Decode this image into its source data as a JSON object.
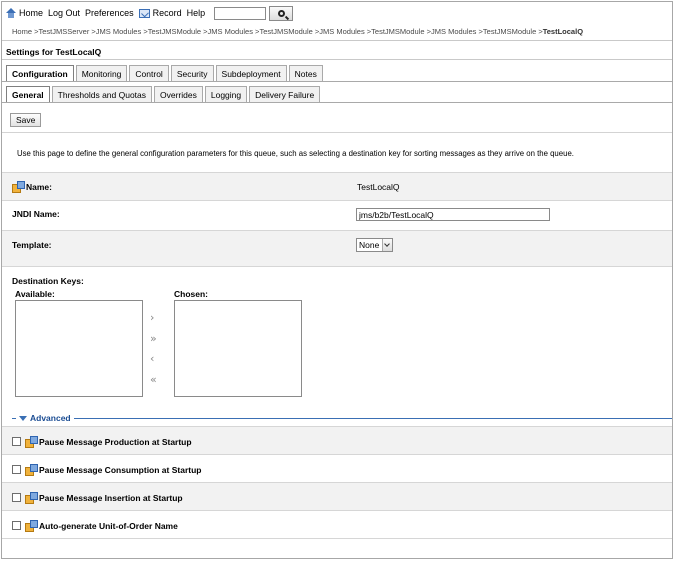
{
  "toolbar": {
    "home": "Home",
    "logout": "Log Out",
    "preferences": "Preferences",
    "record": "Record",
    "help": "Help",
    "search_value": ""
  },
  "breadcrumb": {
    "items": [
      "Home >",
      "TestJMSServer >",
      "JMS Modules >",
      "TestJMSModule >",
      "JMS Modules >",
      "TestJMSModule >",
      "JMS Modules >",
      "TestJMSModule >",
      "JMS Modules >",
      "TestJMSModule >"
    ],
    "current": "TestLocalQ"
  },
  "settings_title": "Settings for TestLocalQ",
  "tabs": [
    "Configuration",
    "Monitoring",
    "Control",
    "Security",
    "Subdeployment",
    "Notes"
  ],
  "subtabs": [
    "General",
    "Thresholds and Quotas",
    "Overrides",
    "Logging",
    "Delivery Failure"
  ],
  "save_label": "Save",
  "description": "Use this page to define the general configuration parameters for this queue, such as selecting a destination key for sorting messages as they arrive on the queue.",
  "form": {
    "name_label": "Name:",
    "name_value": "TestLocalQ",
    "jndi_label": "JNDI Name:",
    "jndi_value": "jms/b2b/TestLocalQ",
    "template_label": "Template:",
    "template_value": "None"
  },
  "destination_keys": {
    "title": "Destination Keys:",
    "available_label": "Available:",
    "chosen_label": "Chosen:"
  },
  "advanced": {
    "label": "Advanced",
    "options": [
      {
        "label": "Pause Message Production at Startup",
        "checked": false
      },
      {
        "label": "Pause Message Consumption at Startup",
        "checked": false
      },
      {
        "label": "Pause Message Insertion at Startup",
        "checked": false
      },
      {
        "label": "Auto-generate Unit-of-Order Name",
        "checked": false
      }
    ]
  }
}
